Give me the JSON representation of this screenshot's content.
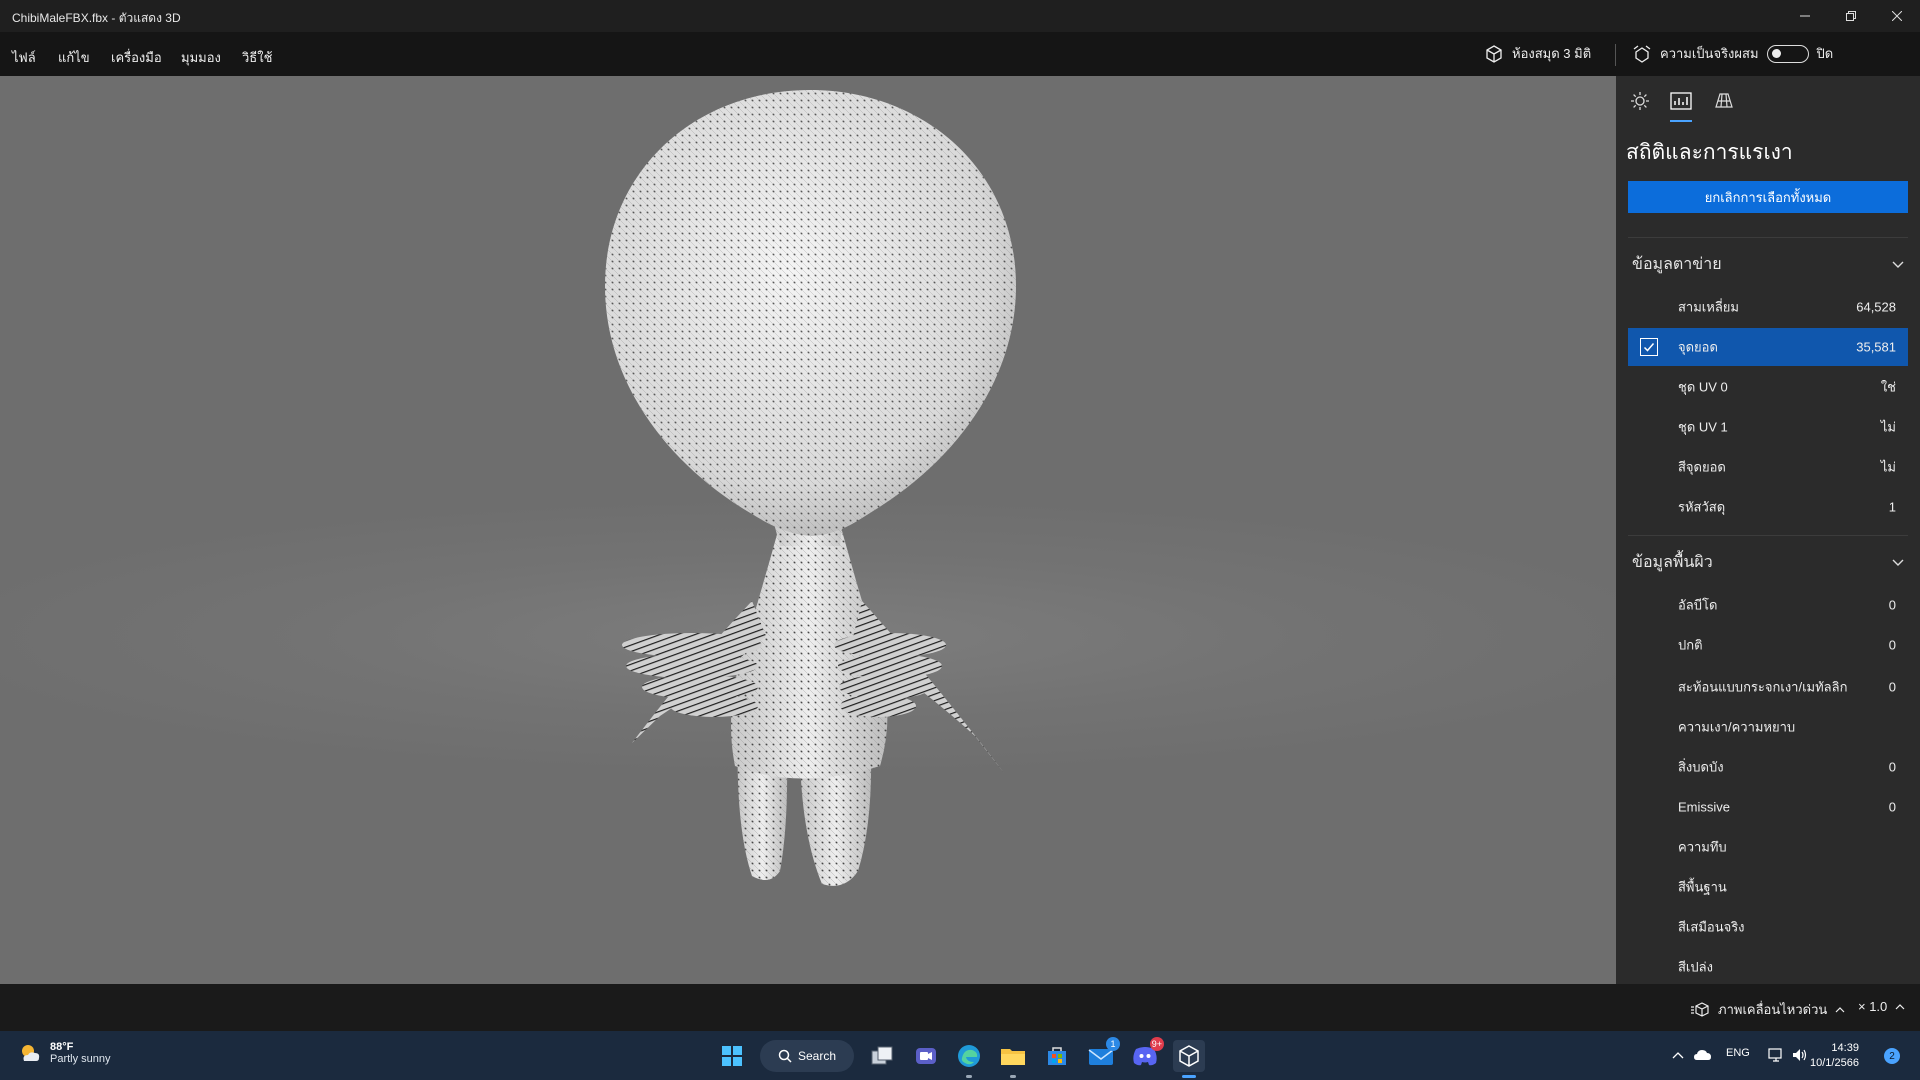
{
  "window": {
    "title": "ChibiMaleFBX.fbx - ตัวแสดง 3D",
    "controls": [
      "minimize",
      "restore",
      "close"
    ]
  },
  "menu": {
    "items": [
      "ไฟล์",
      "แก้ไข",
      "เครื่องมือ",
      "มุมมอง",
      "วิธีใช้"
    ],
    "library_label": "ห้องสมุด 3 มิติ",
    "mixed_reality_label": "ความเป็นจริงผสม",
    "mixed_reality_state": "ปิด",
    "mixed_reality_on": false
  },
  "viewport": {
    "model_name": "ChibiMaleFBX.fbx",
    "display_mode": "wireframe",
    "background_color": "#6f6f6f"
  },
  "panel": {
    "tabs": [
      {
        "name": "lighting",
        "icon": "sun-icon",
        "active": false
      },
      {
        "name": "stats",
        "icon": "stats-icon",
        "active": true
      },
      {
        "name": "grid",
        "icon": "grid-icon",
        "active": false
      }
    ],
    "title": "สถิติและการแรเงา",
    "deselect_all_label": "ยกเลิกการเลือกทั้งหมด",
    "mesh_section": {
      "title": "ข้อมูลตาข่าย",
      "rows": [
        {
          "label": "สามเหลี่ยม",
          "value": "64,528",
          "selected": false
        },
        {
          "label": "จุดยอด",
          "value": "35,581",
          "selected": true
        },
        {
          "label": "ชุด UV 0",
          "value": "ใช่",
          "selected": false
        },
        {
          "label": "ชุด UV 1",
          "value": "ไม่",
          "selected": false
        },
        {
          "label": "สีจุดยอด",
          "value": "ไม่",
          "selected": false
        },
        {
          "label": "รหัสวัสดุ",
          "value": "1",
          "selected": false
        }
      ]
    },
    "surface_section": {
      "title": "ข้อมูลพื้นผิว",
      "rows": [
        {
          "label": "อัลบีโด",
          "value": "0"
        },
        {
          "label": "ปกติ",
          "value": "0"
        },
        {
          "label": "สะท้อนแบบกระจกเงา/เมทัลลิก",
          "value": "0"
        },
        {
          "label": "ความเงา/ความหยาบ",
          "value": ""
        },
        {
          "label": "สิ่งบดบัง",
          "value": "0"
        },
        {
          "label": "Emissive",
          "value": "0"
        },
        {
          "label": "ความทึบ",
          "value": ""
        },
        {
          "label": "สีพื้นฐาน",
          "value": ""
        },
        {
          "label": "สีเสมือนจริง",
          "value": ""
        },
        {
          "label": "สีเปล่ง",
          "value": ""
        }
      ]
    }
  },
  "statusbar": {
    "animation_label": "ภาพเคลื่อนไหวด่วน",
    "speed_label": "× 1.0"
  },
  "taskbar": {
    "weather_temp": "88°F",
    "weather_desc": "Partly sunny",
    "search_label": "Search",
    "apps": [
      {
        "icon": "start-icon",
        "badge": ""
      },
      {
        "icon": "task-view-icon",
        "badge": ""
      },
      {
        "icon": "meet-icon",
        "badge": ""
      },
      {
        "icon": "edge-icon",
        "badge": ""
      },
      {
        "icon": "file-explorer-icon",
        "badge": ""
      },
      {
        "icon": "store-icon",
        "badge": ""
      },
      {
        "icon": "mail-icon",
        "badge": "1"
      },
      {
        "icon": "discord-icon",
        "badge": "9+"
      },
      {
        "icon": "3d-viewer-icon",
        "badge": ""
      }
    ],
    "language": "ENG",
    "time": "14:39",
    "date": "10/1/2566",
    "notification_count": "2",
    "accent_color": "#4aa3ff"
  }
}
